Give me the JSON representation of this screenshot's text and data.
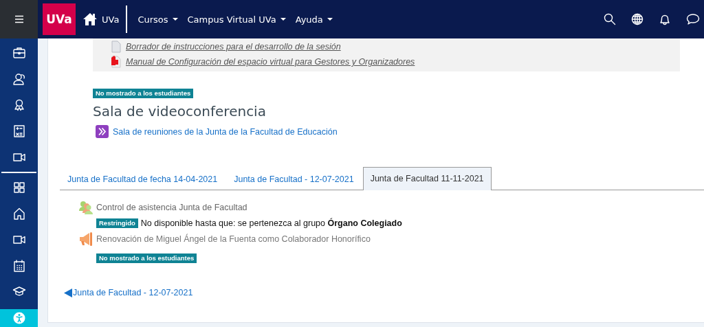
{
  "header": {
    "logo": "UVa",
    "home_label": "UVa",
    "menus": [
      {
        "label": "Cursos"
      },
      {
        "label": "Campus Virtual UVa"
      },
      {
        "label": "Ayuda"
      }
    ]
  },
  "resources": [
    {
      "kind": "file",
      "label": "Borrador de instrucciones para el desarrollo de la sesión"
    },
    {
      "kind": "pdf",
      "label": "Manual de Configuración del espacio virtual para Gestores y Organizadores"
    }
  ],
  "section": {
    "badge": "No mostrado a los estudiantes",
    "title": "Sala de videoconferencia",
    "activity": "Sala de reuniones de la Junta de la Facultad de Educación"
  },
  "tabs": [
    {
      "label": "Junta de Facultad de fecha 14-04-2021",
      "selected": false
    },
    {
      "label": "Junta de Facultad - 12-07-2021",
      "selected": false
    },
    {
      "label": "Junta de Facultad 11-11-2021",
      "selected": true
    }
  ],
  "tab_content": [
    {
      "kind": "attendance",
      "label": "Control de asistencia Junta de Facultad",
      "restriction_badge": "Restringido",
      "restriction": "No disponible hasta que: se pertenezca al grupo **Órgano Colegiado**"
    },
    {
      "kind": "announcement",
      "label": "Renovación de Miguel Ángel de la Fuenta como Colaborador Honorífico",
      "badge": "No mostrado a los estudiantes"
    }
  ],
  "nav_link": "Junta de Facultad - 12-07-2021"
}
